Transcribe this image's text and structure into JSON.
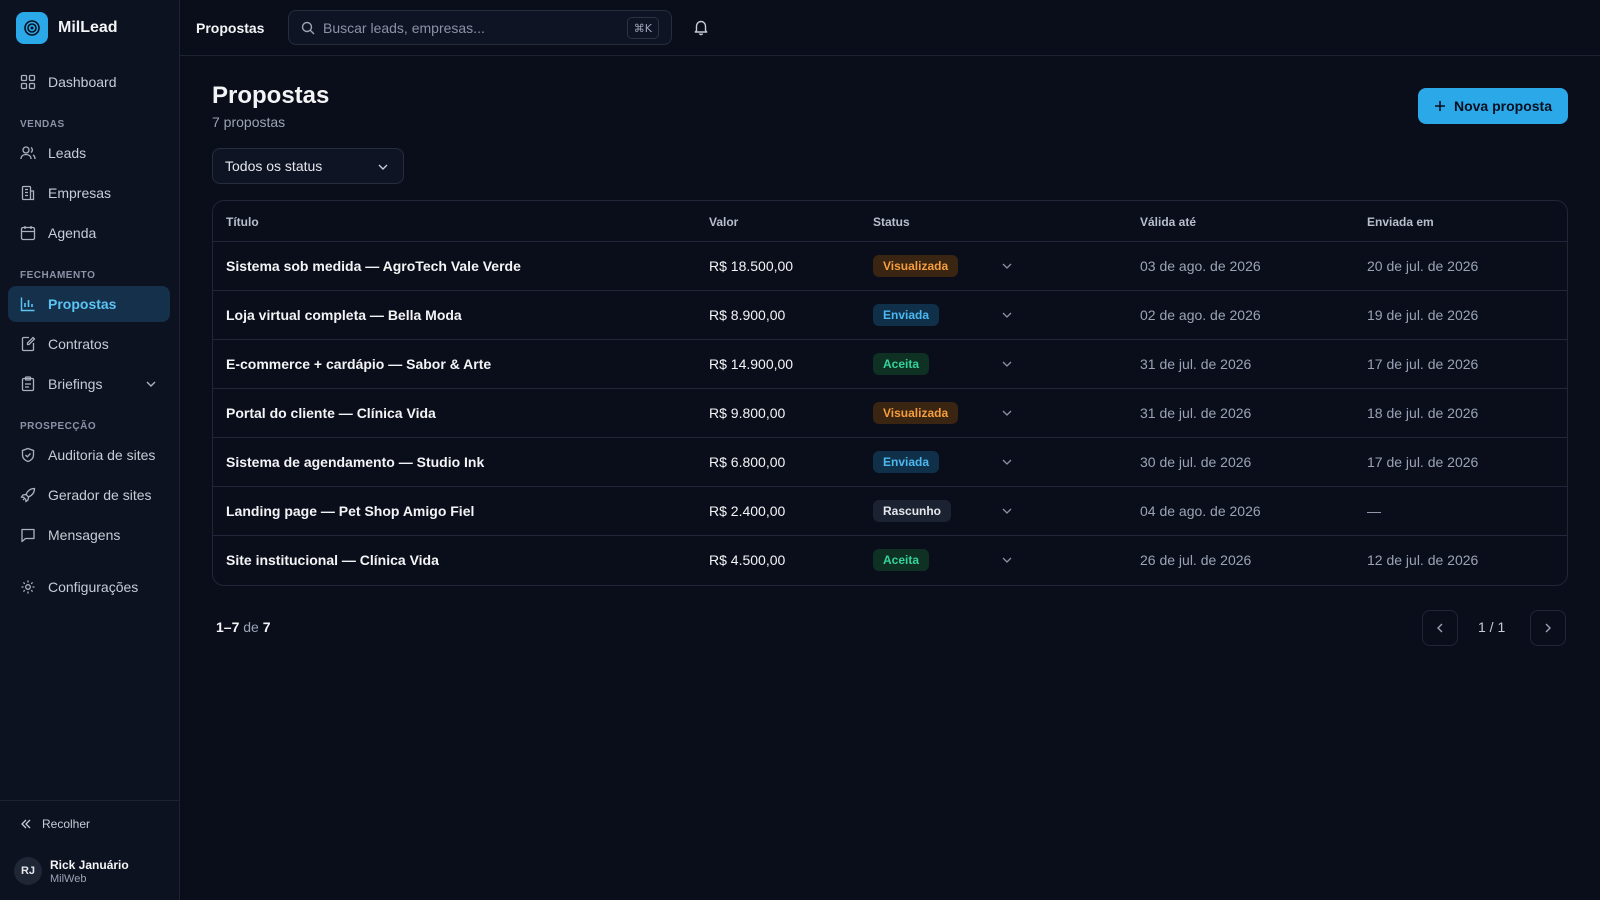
{
  "brand": {
    "name": "MilLead"
  },
  "sidebar": {
    "dashboard": "Dashboard",
    "sections": {
      "vendas": "VENDAS",
      "fechamento": "FECHAMENTO",
      "prospeccao": "PROSPECÇÃO"
    },
    "items": {
      "leads": "Leads",
      "empresas": "Empresas",
      "agenda": "Agenda",
      "propostas": "Propostas",
      "contratos": "Contratos",
      "briefings": "Briefings",
      "auditoria": "Auditoria de sites",
      "gerador": "Gerador de sites",
      "mensagens": "Mensagens",
      "configuracoes": "Configurações"
    },
    "collapse": "Recolher",
    "user": {
      "initials": "RJ",
      "name": "Rick Januário",
      "org": "MilWeb"
    }
  },
  "topbar": {
    "title": "Propostas",
    "search_placeholder": "Buscar leads, empresas...",
    "shortcut": "⌘K"
  },
  "page": {
    "title": "Propostas",
    "subtitle": "7 propostas",
    "new_button": "Nova proposta",
    "filter_value": "Todos os status"
  },
  "table": {
    "columns": {
      "title": "Título",
      "valor": "Valor",
      "status": "Status",
      "valida": "Válida até",
      "enviada": "Enviada em"
    },
    "rows": [
      {
        "title": "Sistema sob medida — AgroTech Vale Verde",
        "valor": "R$ 18.500,00",
        "status": "Visualizada",
        "valida": "03 de ago. de 2026",
        "enviada": "20 de jul. de 2026"
      },
      {
        "title": "Loja virtual completa — Bella Moda",
        "valor": "R$ 8.900,00",
        "status": "Enviada",
        "valida": "02 de ago. de 2026",
        "enviada": "19 de jul. de 2026"
      },
      {
        "title": "E-commerce + cardápio — Sabor & Arte",
        "valor": "R$ 14.900,00",
        "status": "Aceita",
        "valida": "31 de jul. de 2026",
        "enviada": "17 de jul. de 2026"
      },
      {
        "title": "Portal do cliente — Clínica Vida",
        "valor": "R$ 9.800,00",
        "status": "Visualizada",
        "valida": "31 de jul. de 2026",
        "enviada": "18 de jul. de 2026"
      },
      {
        "title": "Sistema de agendamento — Studio Ink",
        "valor": "R$ 6.800,00",
        "status": "Enviada",
        "valida": "30 de jul. de 2026",
        "enviada": "17 de jul. de 2026"
      },
      {
        "title": "Landing page — Pet Shop Amigo Fiel",
        "valor": "R$ 2.400,00",
        "status": "Rascunho",
        "valida": "04 de ago. de 2026",
        "enviada": "—"
      },
      {
        "title": "Site institucional — Clínica Vida",
        "valor": "R$ 4.500,00",
        "status": "Aceita",
        "valida": "26 de jul. de 2026",
        "enviada": "12 de jul. de 2026"
      }
    ]
  },
  "pager": {
    "range": "1–7",
    "of": "de",
    "total": "7",
    "page": "1 / 1"
  },
  "colors": {
    "accent": "#2aa8e8",
    "background": "#0a0e1a",
    "sidebar": "#0d1220",
    "status_visualizada": "#f59e3d",
    "status_enviada": "#4cb8f0",
    "status_aceita": "#34d399"
  }
}
